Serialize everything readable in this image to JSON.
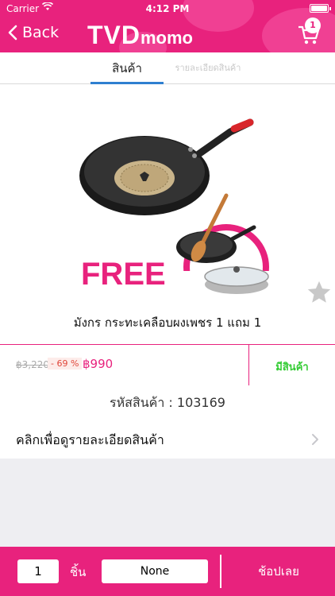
{
  "status_bar": {
    "carrier": "Carrier",
    "time": "4:12 PM"
  },
  "header": {
    "back_label": "Back",
    "logo_main": "TVD",
    "logo_suffix": "momo",
    "cart_count": "1",
    "brand_color": "#e8227d"
  },
  "tabs": [
    {
      "label": "สินค้า",
      "active": true
    },
    {
      "label": "รายละเอียดสินค้า",
      "active": false
    }
  ],
  "product": {
    "title": "มังกร กระทะเคลือบผงเพชร 1 แถม 1",
    "image_free_text": "FREE",
    "old_price": "฿3,220",
    "discount": "- 69 %",
    "price": "฿990",
    "stock_status": "มีสินค้า",
    "code_label": "รหัสสินค้า : 103169",
    "detail_link": "คลิกเพื่อดูรายละเอียดสินค้า"
  },
  "purchase_bar": {
    "quantity": "1",
    "unit": "ชิ้น",
    "option": "None",
    "buy_label": "ช้อปเลย"
  },
  "icons": [
    "back-chevron-icon",
    "cart-icon",
    "star-icon",
    "chevron-right-icon",
    "wifi-icon",
    "battery-icon"
  ]
}
